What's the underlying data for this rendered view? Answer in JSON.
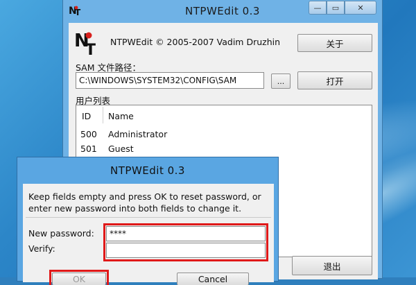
{
  "main_window": {
    "title": "NTPWEdit 0.3",
    "about_text": "NTPWEdit © 2005-2007 Vadim Druzhin",
    "about_button": "关于",
    "sam_label": "SAM 文件路径：",
    "sam_path": "C:\\WINDOWS\\SYSTEM32\\CONFIG\\SAM",
    "browse_button": "...",
    "open_button": "打开",
    "users_label": "用户列表",
    "columns": {
      "id": "ID",
      "name": "Name"
    },
    "users": [
      {
        "id": "500",
        "name": "Administrator"
      },
      {
        "id": "501",
        "name": "Guest"
      }
    ],
    "exit_button": "退出"
  },
  "dialog": {
    "title": "NTPWEdit 0.3",
    "message": "Keep fields empty and press OK to reset password, or enter new password into both fields to change it.",
    "new_password_label": "New password:",
    "new_password_value": "****",
    "verify_label": "Verify:",
    "verify_value": "",
    "ok_button": "OK",
    "cancel_button": "Cancel"
  },
  "colors": {
    "highlight": "#e01919",
    "window_frame": "#6fb2e6",
    "dialog_frame": "#5aa6e2"
  }
}
